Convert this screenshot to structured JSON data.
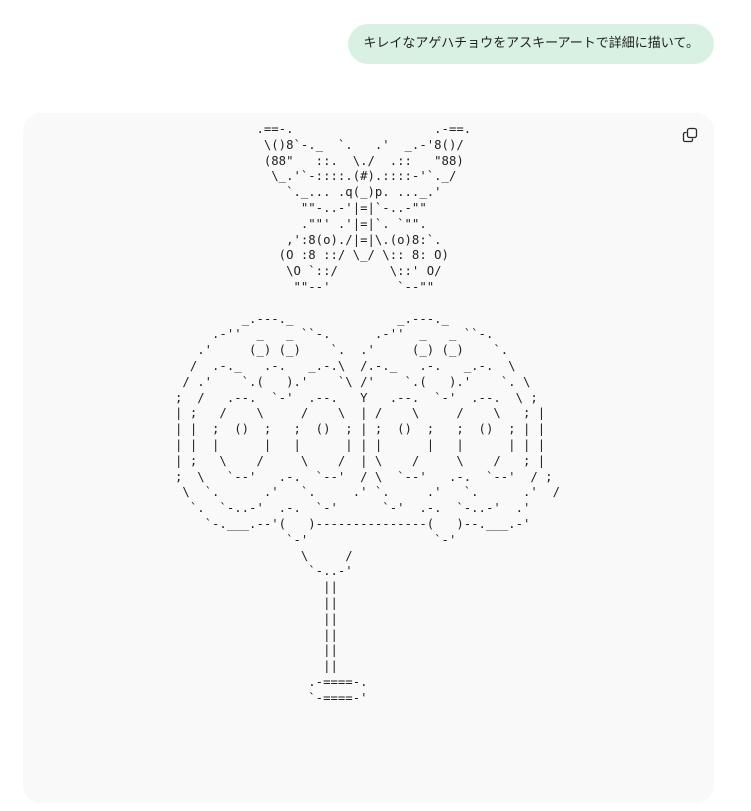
{
  "user_message": {
    "text": "キレイなアゲハチョウをアスキーアートで詳細に描いて。"
  },
  "code_block": {
    "copy_icon": "copy-icon",
    "content": "                .==-.                   .-==.\n                 \\()8`-._  `.   .'  _.-'8()/\n                 (88\"   ::.  \\./  .::   \"88)\n                  \\_.'`-::::.(#).::::-'`._/\n                    `._... .q(_)p. ..._.'\n                      \"\"-..-'|=|`-..-\"\"\n                      .\"\"' .'|=|`. `\"\".\n                    ,':8(o)./|=|\\.(o)8:`.\n                   (O :8 ::/ \\_/ \\:: 8: O)\n                    \\O `::/       \\::' O/\n                     \"\"--'         `--\"\"\n\n              _.---._              _.---._\n          .-''  _   _ ``-.      .-''  _   _ ``-.\n        .'     (_) (_)    `.  .'     (_) (_)    `.\n       /  .-._   .-.   _.-.\\  /.-._   .-.   _.-.  \\\n      / .'    `.(   ).'    `\\ /'    `.(   ).'    `. \\\n     ;  /   .--.  `-'  .--.   Y   .--.  `-'  .--.  \\ ;\n     | ;   /    \\     /    \\  | /    \\     /    \\   ; |\n     | |  ;  ()  ;   ;  ()  ; | ;  ()  ;   ;  ()  ; | |\n     | |  |      |   |      | | |      |   |      | | |\n     | ;   \\    /     \\    /  | \\    /     \\    /   ; |\n     ;  \\   `--'   .-.  `--'  / \\  `--'   .-.  `--'  / ;\n      \\  `.      .'   `.     .' `.     .'   `.      .'  /\n       `.  `-..-'  .-.  `-'      `-'  .-.  `-..-'  .'\n         `-.___.--'(   )---------------(   )--.___.-'\n                    `-'                 `-'\n                      \\     /\n                       `-..-'\n                         ||\n                         ||\n                         ||\n                         ||\n                         ||\n                         ||\n                       .-====-.\n                       `-====-'"
  }
}
